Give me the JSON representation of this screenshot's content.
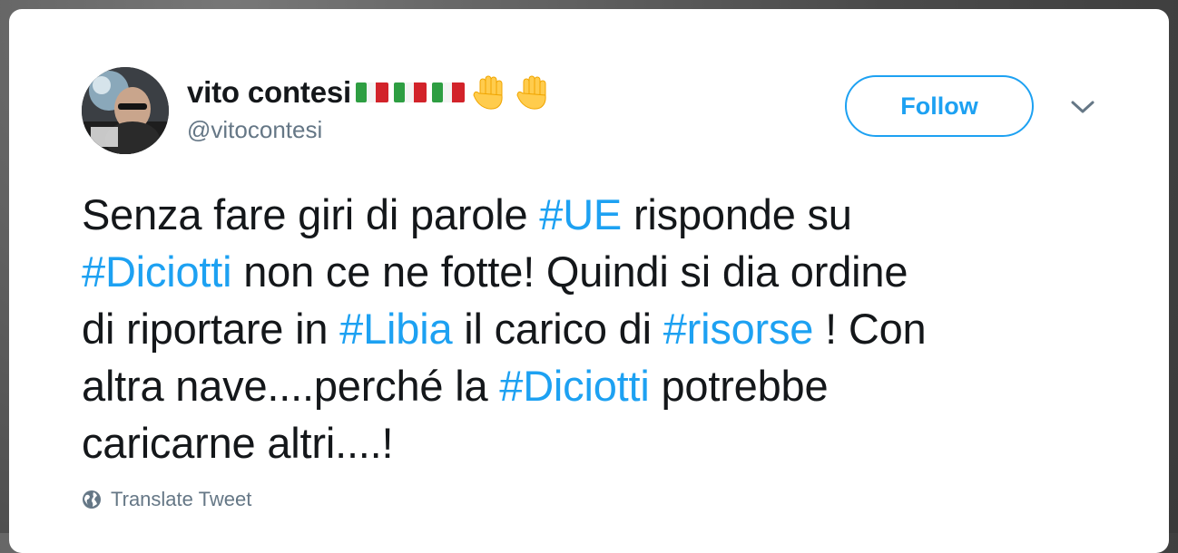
{
  "user": {
    "display_name": "vito contesi",
    "handle": "@vitocontesi"
  },
  "follow_label": "Follow",
  "tweet": {
    "lines": [
      [
        {
          "t": "Senza fare giri di parole ",
          "h": false
        },
        {
          "t": "#UE",
          "h": true
        },
        {
          "t": " risponde su",
          "h": false
        }
      ],
      [
        {
          "t": "#Diciotti",
          "h": true
        },
        {
          "t": " non ce ne fotte! Quindi si dia ordine",
          "h": false
        }
      ],
      [
        {
          "t": "di riportare in ",
          "h": false
        },
        {
          "t": "#Libia",
          "h": true
        },
        {
          "t": " il carico di ",
          "h": false
        },
        {
          "t": "#risorse",
          "h": true
        },
        {
          "t": " ! Con",
          "h": false
        }
      ],
      [
        {
          "t": "altra nave....perché la ",
          "h": false
        },
        {
          "t": "#Diciotti",
          "h": true
        },
        {
          "t": " potrebbe",
          "h": false
        }
      ],
      [
        {
          "t": "caricarne altri....!",
          "h": false
        }
      ]
    ]
  },
  "translate_label": "Translate Tweet",
  "colors": {
    "link": "#1da1f2",
    "text": "#14171a",
    "secondary": "#657786"
  },
  "icons": {
    "flag": "italy-flag-icon",
    "hand": "raised-hand-icon",
    "caret": "chevron-down-icon",
    "globe": "globe-icon"
  }
}
